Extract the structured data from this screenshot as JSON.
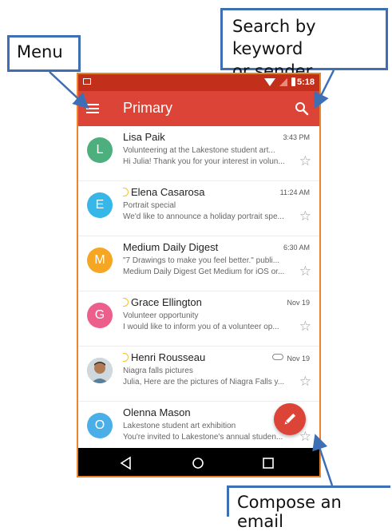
{
  "callouts": {
    "menu": "Menu",
    "search_line1": "Search by keyword",
    "search_line2": "or sender",
    "compose": "Compose an email"
  },
  "status_bar": {
    "time": "5:18"
  },
  "app_bar": {
    "title": "Primary",
    "menu_icon": "hamburger-menu-icon",
    "search_icon": "search-icon"
  },
  "colors": {
    "app_bar": "#db4437",
    "status_bar": "#c2301c",
    "callout_border": "#3e6fb4",
    "phone_border": "#e8852c"
  },
  "emails": [
    {
      "avatar": "L",
      "avatar_color": "#4caf7d",
      "sender": "Lisa Paik",
      "important": false,
      "time": "3:43 PM",
      "subject": "Volunteering at the Lakestone student art...",
      "snippet": "Hi Julia! Thank you for your interest in volun..."
    },
    {
      "avatar": "E",
      "avatar_color": "#36b7e8",
      "sender": "Elena Casarosa",
      "important": true,
      "time": "11:24 AM",
      "subject": "Portrait special",
      "snippet": "We'd like to announce a holiday portrait spe..."
    },
    {
      "avatar": "M",
      "avatar_color": "#f5a623",
      "sender": "Medium Daily Digest",
      "important": false,
      "time": "6:30 AM",
      "subject": "\"7 Drawings to make you feel better.\" publi...",
      "snippet": "Medium Daily Digest Get Medium for iOS or..."
    },
    {
      "avatar": "G",
      "avatar_color": "#ec5f8c",
      "sender": "Grace Ellington",
      "important": true,
      "time": "Nov 19",
      "subject": "Volunteer opportunity",
      "snippet": "I would like to inform you of a volunteer op..."
    },
    {
      "avatar": "photo",
      "avatar_color": "#bfc8cc",
      "sender": "Henri Rousseau",
      "important": true,
      "attachment": true,
      "time": "Nov 19",
      "subject": "Niagra falls pictures",
      "snippet": "Julia, Here are the pictures of Niagra Falls y..."
    },
    {
      "avatar": "O",
      "avatar_color": "#4aaee8",
      "sender": "Olenna Mason",
      "important": false,
      "time": "",
      "subject": "Lakestone student art exhibition",
      "snippet": "You're invited to Lakestone's annual studen..."
    }
  ],
  "compose_icon": "pencil-icon",
  "nav_bar": {
    "back_icon": "back-triangle-icon",
    "home_icon": "home-circle-icon",
    "recents_icon": "recents-square-icon"
  }
}
